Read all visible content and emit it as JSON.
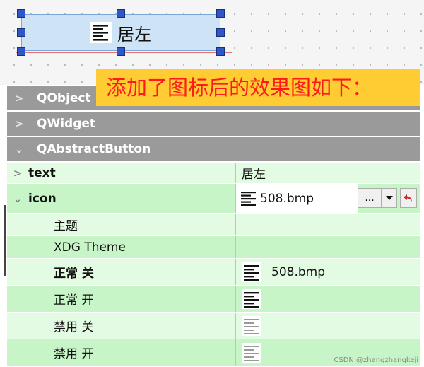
{
  "preview": {
    "label": "居左",
    "icon": "align-left-icon"
  },
  "annotation": {
    "text": "添加了图标后的效果图如下："
  },
  "groups": [
    {
      "name": "QObject",
      "chevron": ">"
    },
    {
      "name": "QWidget",
      "chevron": ">"
    },
    {
      "name": "QAbstractButton",
      "chevron": "⌄"
    }
  ],
  "properties": {
    "text": {
      "name": "text",
      "value": "居左",
      "chevron": ">"
    },
    "icon": {
      "name": "icon",
      "value": "508.bmp",
      "chevron": "⌄",
      "browse_label": "...",
      "dropdown_icon": "chevron-down-icon",
      "reset_icon": "reset-arrow-icon"
    },
    "theme": {
      "name": "主题",
      "value": ""
    },
    "xdg_theme": {
      "name": "XDG Theme",
      "value": ""
    },
    "normal_off": {
      "name": "正常 关",
      "value": "508.bmp"
    },
    "normal_on": {
      "name": "正常 开",
      "value": ""
    },
    "disabled_off": {
      "name": "禁用 关",
      "value": ""
    },
    "disabled_on": {
      "name": "禁用 开",
      "value": ""
    }
  },
  "colors": {
    "group_bg": "#9a9a9a",
    "row_light": "#e2fbe2",
    "row_dark": "#c8f5c8",
    "annotation_bg": "#ffcc33",
    "annotation_text": "#ff1a1a",
    "handle": "#2f57c8"
  },
  "watermark": "CSDN @zhangzhangkeji"
}
